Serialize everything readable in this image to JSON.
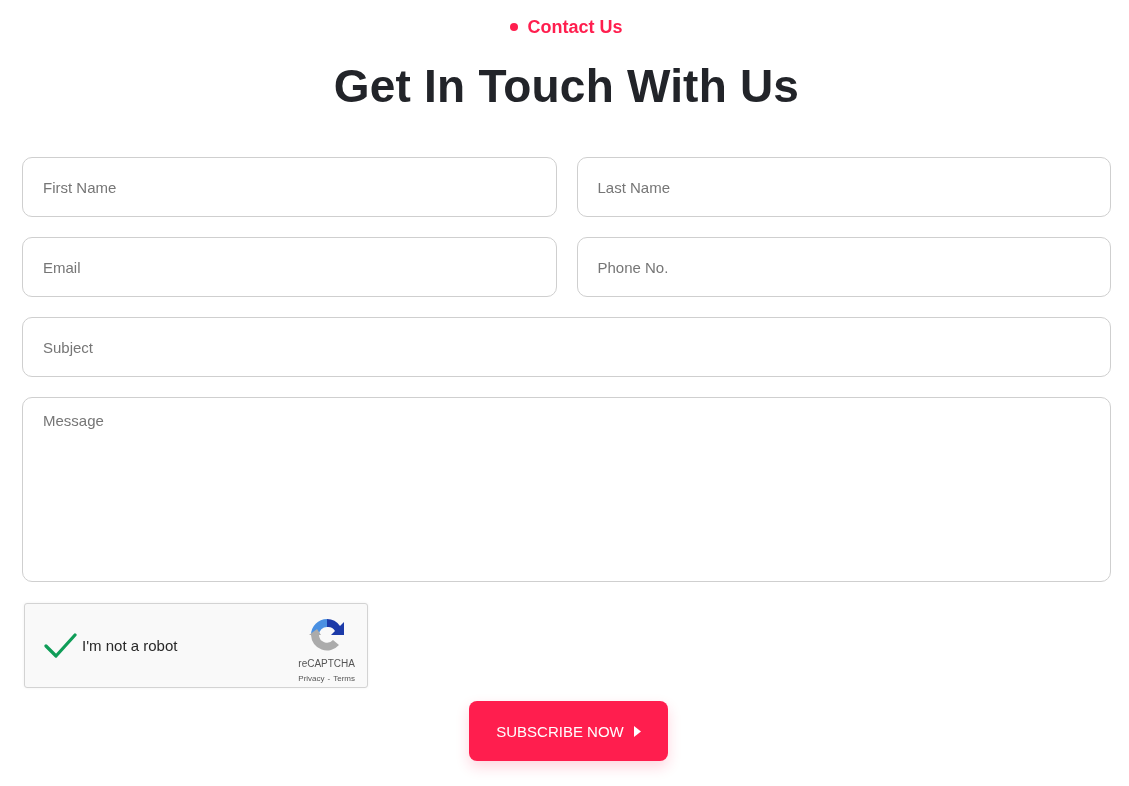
{
  "eyebrow": {
    "label": "Contact Us"
  },
  "title": "Get In Touch With Us",
  "form": {
    "rows": [
      [
        {
          "kind": "input",
          "placeholder": "First Name"
        },
        {
          "kind": "input",
          "placeholder": "Last Name"
        }
      ],
      [
        {
          "kind": "input",
          "placeholder": "Email"
        },
        {
          "kind": "input",
          "placeholder": "Phone No."
        }
      ],
      [
        {
          "kind": "input",
          "placeholder": "Subject"
        }
      ],
      [
        {
          "kind": "textarea",
          "placeholder": "Message"
        }
      ]
    ]
  },
  "captcha": {
    "label": "I'm not a robot",
    "checked": true,
    "brand": "reCAPTCHA",
    "links": [
      {
        "label": "Privacy"
      },
      {
        "label": "Terms"
      }
    ],
    "separator": "-"
  },
  "submit_button": {
    "label": "SUBSCRIBE NOW"
  }
}
